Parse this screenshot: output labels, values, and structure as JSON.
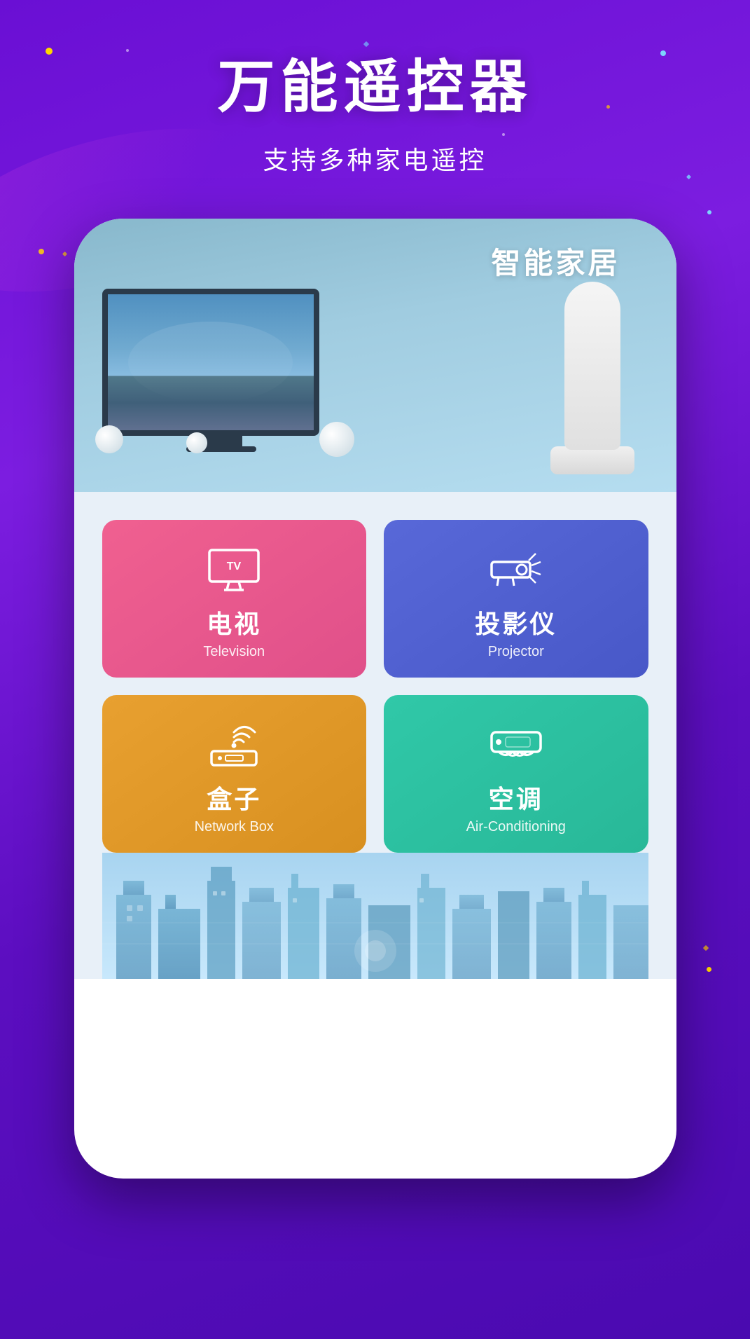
{
  "header": {
    "main_title": "万能遥控器",
    "sub_title": "支持多种家电遥控"
  },
  "banner": {
    "title": "智能家居"
  },
  "grid": {
    "items": [
      {
        "id": "television",
        "name_cn": "电视",
        "name_en": "Television",
        "color_class": "television"
      },
      {
        "id": "projector",
        "name_cn": "投影仪",
        "name_en": "Projector",
        "color_class": "projector"
      },
      {
        "id": "network-box",
        "name_cn": "盒子",
        "name_en": "Network Box",
        "color_class": "network-box"
      },
      {
        "id": "air-conditioning",
        "name_cn": "空调",
        "name_en": "Air-Conditioning",
        "color_class": "air-conditioning"
      }
    ]
  }
}
